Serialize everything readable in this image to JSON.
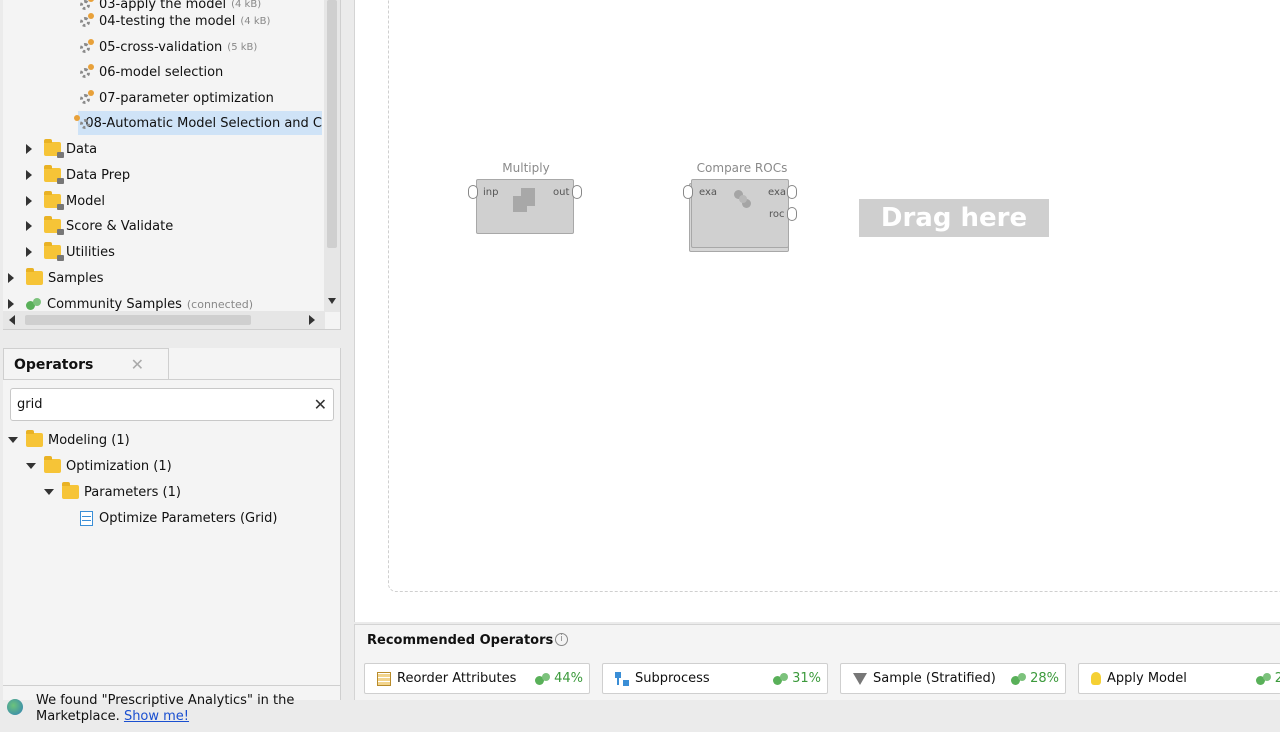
{
  "repository": {
    "items": [
      {
        "label": "03-apply the model",
        "size": "(4 kB)"
      },
      {
        "label": "04-testing the model",
        "size": "(4 kB)"
      },
      {
        "label": "05-cross-validation",
        "size": "(5 kB)"
      },
      {
        "label": "06-model selection",
        "size": ""
      },
      {
        "label": "07-parameter optimization",
        "size": ""
      },
      {
        "label": "08-Automatic Model Selection and C",
        "size": ""
      }
    ],
    "folders": [
      "Data",
      "Data Prep",
      "Model",
      "Score & Validate",
      "Utilities"
    ],
    "samples_label": "Samples",
    "community_label": "Community Samples",
    "community_status": "(connected)"
  },
  "operators_panel": {
    "tab_label": "Operators",
    "close_glyph": "✕",
    "search_value": "grid",
    "clear_glyph": "✕",
    "tree": [
      {
        "label": "Modeling (1)"
      },
      {
        "label": "Optimization (1)"
      },
      {
        "label": "Parameters (1)"
      },
      {
        "label": "Optimize Parameters (Grid)"
      }
    ],
    "marketplace_text": "We found \"Prescriptive Analytics\" in the Marketplace.",
    "marketplace_link": "Show me!"
  },
  "canvas": {
    "multiply": {
      "title": "Multiply",
      "in_port": "inp",
      "out_port": "out"
    },
    "compare_rocs": {
      "title": "Compare ROCs",
      "in_port": "exa",
      "out_port1": "exa",
      "out_port2": "roc"
    },
    "drag_hint": "Drag here"
  },
  "recommended": {
    "title": "Recommended Operators",
    "info_glyph": "i",
    "items": [
      {
        "label": "Reorder Attributes",
        "pct": "44%",
        "icon": "table-icon"
      },
      {
        "label": "Subprocess",
        "pct": "31%",
        "icon": "subprocess-icon"
      },
      {
        "label": "Sample (Stratified)",
        "pct": "28%",
        "icon": "funnel-icon"
      },
      {
        "label": "Apply Model",
        "pct": "2",
        "icon": "bulb-icon"
      }
    ]
  },
  "colors": {
    "selection": "#cfe3f7",
    "folder": "#f6c437",
    "accent_link": "#1a4fd0",
    "percent": "#3c9a3c"
  }
}
